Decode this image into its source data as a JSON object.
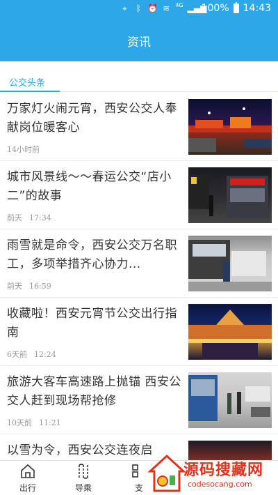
{
  "status_bar": {
    "network": "4G",
    "battery": "100%",
    "time": "14:43"
  },
  "header": {
    "title": "资讯"
  },
  "section_tab": {
    "label": "公交头条"
  },
  "news": [
    {
      "title": "万家灯火闹元宵，西安公交人奉献岗位暖客心",
      "date": "14小时前",
      "time": ""
    },
    {
      "title": "城市风景线～～春运公交“店小二”的故事",
      "date": "前天",
      "time": "17:34"
    },
    {
      "title": "雨雪就是命令，西安公交万名职工，多项举措齐心协力...",
      "date": "前天",
      "time": "16:59"
    },
    {
      "title": "收藏啦！西安元宵节公交出行指南",
      "date": "6天前",
      "time": "12:24"
    },
    {
      "title": "旅游大客车高速路上抛锚 西安公交人赶到现场帮抢修",
      "date": "10天前",
      "time": "11:21"
    },
    {
      "title": "以雪为令，西安公交连夜启",
      "date": "",
      "time": ""
    }
  ],
  "bottom_nav": [
    {
      "label": "出行",
      "icon": "home-icon"
    },
    {
      "label": "导乘",
      "icon": "route-icon"
    },
    {
      "label": "支",
      "icon": "pay-icon"
    }
  ],
  "watermark": {
    "title": "源码搜藏网",
    "url": "codesocang.com"
  }
}
